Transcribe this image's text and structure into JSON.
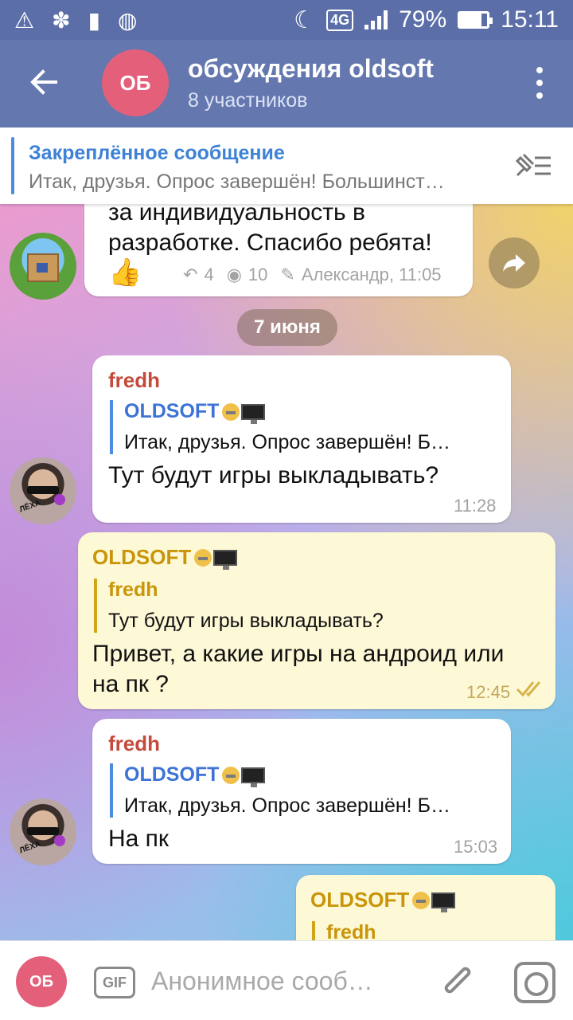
{
  "status": {
    "battery": "79%",
    "time": "15:11",
    "network": "4G",
    "battery_level": 0.79
  },
  "header": {
    "avatar_initials": "ОБ",
    "title": "обсуждения oldsoft",
    "subtitle": "8 участников"
  },
  "pinned": {
    "title": "Закреплённое сообщение",
    "text": "Итак, друзья. Опрос завершён!  Большинст…"
  },
  "messages": {
    "m0": {
      "line1": "за индивидуальность в",
      "line2": "разработке. Спасибо ребята!",
      "emoji": "👍",
      "replies": "4",
      "views": "10",
      "signature": "Александр, 11:05"
    },
    "date": "7 июня",
    "m1": {
      "sender": "fredh",
      "reply_name": "OLDSOFT",
      "reply_text": "Итак, друзья. Опрос завершён!  Б…",
      "text": "Тут будут игры выкладывать?",
      "time": "11:28"
    },
    "m2": {
      "sender": "OLDSOFT",
      "reply_name": "fredh",
      "reply_text": "Тут будут игры выкладывать?",
      "line1": "Привет, а какие игры на андроид или",
      "line2": "на пк ?",
      "time": "12:45"
    },
    "m3": {
      "sender": "fredh",
      "reply_name": "OLDSOFT",
      "reply_text": "Итак, друзья. Опрос завершён!  Б…",
      "text": "На пк",
      "time": "15:03"
    },
    "m4": {
      "sender": "OLDSOFT",
      "reply_name": "fredh"
    }
  },
  "avatar_tag": "ЛЁХА",
  "input": {
    "avatar_initials": "ОБ",
    "gif": "GIF",
    "placeholder": "Анонимное сооб…"
  }
}
